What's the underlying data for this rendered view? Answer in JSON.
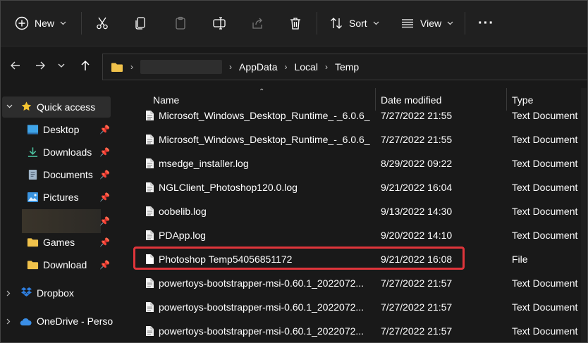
{
  "toolbar": {
    "new_label": "New",
    "sort_label": "Sort",
    "view_label": "View",
    "more_label": "···"
  },
  "address": {
    "crumbs": [
      "AppData",
      "Local",
      "Temp"
    ]
  },
  "sidebar": {
    "quick_access": "Quick access",
    "items": [
      {
        "label": "Desktop",
        "icon": "desktop-icon"
      },
      {
        "label": "Downloads",
        "icon": "download-arrow-icon"
      },
      {
        "label": "Documents",
        "icon": "documents-icon"
      },
      {
        "label": "Pictures",
        "icon": "pictures-icon"
      },
      {
        "label": "Games",
        "icon": "folder-icon"
      },
      {
        "label": "Download",
        "icon": "folder-icon"
      }
    ],
    "dropbox": "Dropbox",
    "onedrive": "OneDrive - Perso"
  },
  "list": {
    "columns": {
      "name": "Name",
      "date": "Date modified",
      "type": "Type"
    },
    "rows": [
      {
        "name": "Microsoft_Windows_Desktop_Runtime_-_6.0.6_...",
        "date": "7/27/2022 21:55",
        "type": "Text Document"
      },
      {
        "name": "Microsoft_Windows_Desktop_Runtime_-_6.0.6_...",
        "date": "7/27/2022 21:55",
        "type": "Text Document"
      },
      {
        "name": "msedge_installer.log",
        "date": "8/29/2022 09:22",
        "type": "Text Document"
      },
      {
        "name": "NGLClient_Photoshop120.0.log",
        "date": "9/21/2022 16:04",
        "type": "Text Document"
      },
      {
        "name": "oobelib.log",
        "date": "9/13/2022 14:30",
        "type": "Text Document"
      },
      {
        "name": "PDApp.log",
        "date": "9/20/2022 14:10",
        "type": "Text Document"
      },
      {
        "name": "Photoshop Temp54056851172",
        "date": "9/21/2022 16:08",
        "type": "File"
      },
      {
        "name": "powertoys-bootstrapper-msi-0.60.1_2022072...",
        "date": "7/27/2022 21:57",
        "type": "Text Document"
      },
      {
        "name": "powertoys-bootstrapper-msi-0.60.1_2022072...",
        "date": "7/27/2022 21:57",
        "type": "Text Document"
      },
      {
        "name": "powertoys-bootstrapper-msi-0.60.1_2022072...",
        "date": "7/27/2022 21:57",
        "type": "Text Document"
      }
    ]
  },
  "colors": {
    "highlight": "#e0353b",
    "folder": "#f0c24b",
    "star": "#f4c430",
    "dropbox": "#2f7fe0",
    "onedrive": "#3a8ee6"
  }
}
